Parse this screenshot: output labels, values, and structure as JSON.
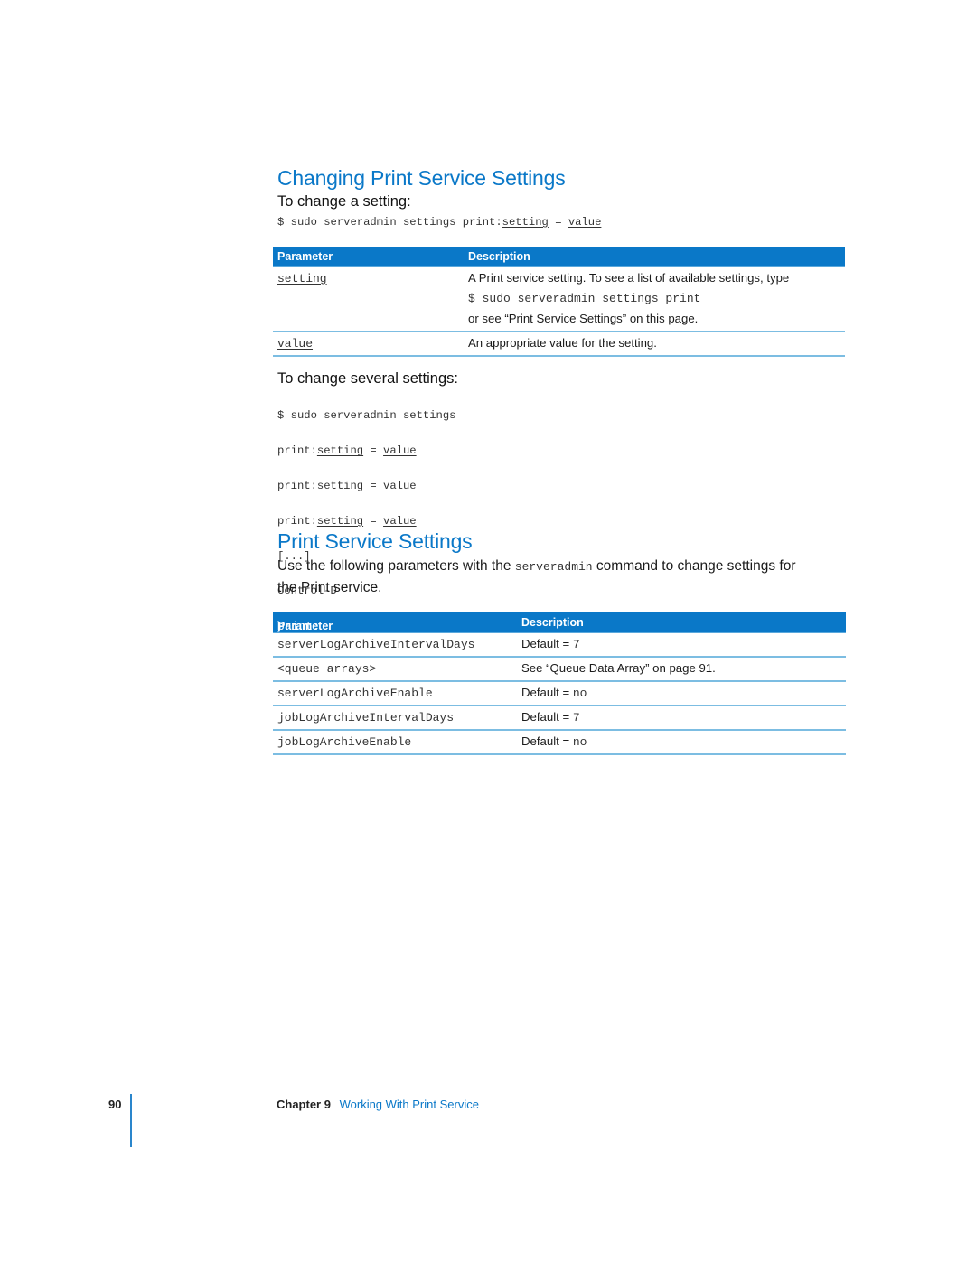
{
  "section1": {
    "title": "Changing Print Service Settings",
    "single": {
      "heading": "To change a setting:",
      "command_prefix": "$ sudo serveradmin settings print:",
      "command_setting": "setting",
      "command_eq": " = ",
      "command_value": "value"
    },
    "table": {
      "headers": [
        "Parameter",
        "Description"
      ],
      "rows": [
        {
          "param": "setting",
          "desc_line1": "A Print service setting. To see a list of available settings, type",
          "desc_code": "$ sudo serveradmin settings print",
          "desc_line3": "or see “Print Service Settings” on this page."
        },
        {
          "param": "value",
          "desc_line1": "An appropriate value for the setting."
        }
      ]
    },
    "multiple": {
      "heading": "To change several settings:",
      "line1": "$ sudo serveradmin settings",
      "lines": [
        {
          "prefix": "print:",
          "setting": "setting",
          "eq": " = ",
          "value": "value"
        },
        {
          "prefix": "print:",
          "setting": "setting",
          "eq": " = ",
          "value": "value"
        },
        {
          "prefix": "print:",
          "setting": "setting",
          "eq": " = ",
          "value": "value"
        }
      ],
      "ellipsis": "[...]",
      "end": "Control-D"
    }
  },
  "section2": {
    "title": "Print Service Settings",
    "intro_before": "Use the following parameters with the ",
    "intro_code": "serveradmin",
    "intro_after_line1": " command to change settings for",
    "intro_line2": "the Print service.",
    "table": {
      "header_param": "Parameter (",
      "header_param_code": "print:",
      "header_param_close": ")",
      "header_desc": "Description",
      "rows": [
        {
          "param": "serverLogArchiveIntervalDays",
          "desc_text": "Default = ",
          "desc_code": "7"
        },
        {
          "param": "<queue arrays>",
          "desc_text": "See “Queue Data Array” on page 91.",
          "desc_code": ""
        },
        {
          "param": "serverLogArchiveEnable",
          "desc_text": "Default = ",
          "desc_code": "no"
        },
        {
          "param": "jobLogArchiveIntervalDays",
          "desc_text": "Default = ",
          "desc_code": "7"
        },
        {
          "param": "jobLogArchiveEnable",
          "desc_text": "Default = ",
          "desc_code": "no"
        }
      ]
    }
  },
  "footer": {
    "page_number": "90",
    "chapter_label": "Chapter 9",
    "chapter_title": "Working With Print Service"
  },
  "colors": {
    "accent": "#0a78c8",
    "rule": "#7cbde2"
  }
}
